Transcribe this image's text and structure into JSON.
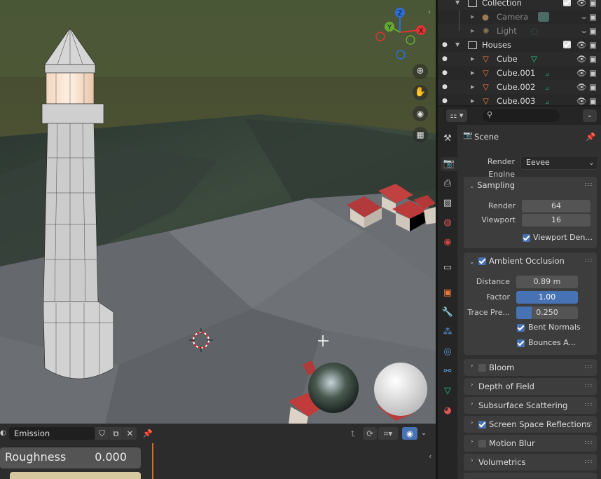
{
  "outliner": {
    "rows": [
      {
        "label": "Collection"
      },
      {
        "label": "Camera"
      },
      {
        "label": "Light"
      },
      {
        "label": "Houses"
      },
      {
        "label": "Cube"
      },
      {
        "label": "Cube.001"
      },
      {
        "label": "Cube.002"
      },
      {
        "label": "Cube.003"
      }
    ]
  },
  "props": {
    "search_placeholder": "",
    "scene_label": "Scene",
    "render_engine_label": "Render Engine",
    "render_engine_value": "Eevee",
    "sampling": {
      "title": "Sampling",
      "render_label": "Render",
      "render_value": "64",
      "viewport_label": "Viewport",
      "viewport_value": "16",
      "viewport_denoise_label": "Viewport Den..."
    },
    "ao": {
      "title": "Ambient Occlusion",
      "distance_label": "Distance",
      "distance_value": "0.89 m",
      "factor_label": "Factor",
      "factor_value": "1.00",
      "trace_label": "Trace Pre...",
      "trace_value": "0.250",
      "bent_label": "Bent Normals",
      "bounces_label": "Bounces A..."
    },
    "panels": [
      {
        "title": "Bloom"
      },
      {
        "title": "Depth of Field"
      },
      {
        "title": "Subsurface Scattering"
      },
      {
        "title": "Screen Space Reflections"
      },
      {
        "title": "Motion Blur"
      },
      {
        "title": "Volumetrics"
      }
    ]
  },
  "bottom": {
    "material_name": "Emission",
    "roughness_label": "Roughness",
    "roughness_value": "0.000"
  },
  "colors": {
    "accent": "#4772b3",
    "orange": "#e8783a",
    "green": "#1dc47e"
  }
}
